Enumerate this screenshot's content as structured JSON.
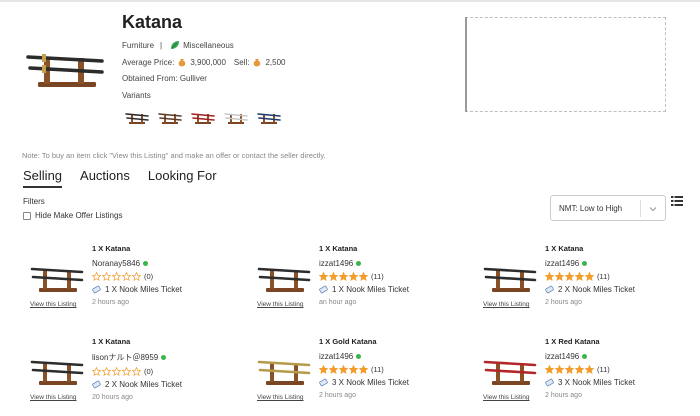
{
  "item": {
    "title": "Katana",
    "category": "Furniture",
    "separator": "|",
    "subcategory": "Miscellaneous",
    "avg_price_label": "Average Price:",
    "avg_price": "3,900,000",
    "sell_label": "Sell:",
    "sell_price": "2,500",
    "obtained_label": "Obtained From:",
    "obtained_from": "Gulliver",
    "variants_label": "Variants",
    "variant_colors": [
      "#2d2d2d",
      "#5a3b2a",
      "#a31f1f",
      "#c8c8c8",
      "#1f3a6b"
    ]
  },
  "note": "Note: To buy an item click \"View this Listing\" and make an offer or contact the seller directly.",
  "tabs": [
    {
      "label": "Selling"
    },
    {
      "label": "Auctions"
    },
    {
      "label": "Looking For"
    }
  ],
  "filters": {
    "label": "Filters",
    "hide_make_offer": "Hide Make Offer Listings",
    "sort_selected": "NMT: Low to High"
  },
  "icons": {
    "leaf": "leaf-icon",
    "bells": "bell-bag-icon",
    "ticket": "nook-miles-ticket-icon",
    "list_view": "list-view-icon",
    "chevron": "chevron-down-icon"
  },
  "colors": {
    "star": "#f39c2a",
    "online": "#39b54a",
    "leaf": "#3aa757"
  },
  "listings": [
    {
      "title": "1 X Katana",
      "seller": "Noranay5846",
      "rating": 0,
      "reviews": "(0)",
      "price": "1 X Nook Miles Ticket",
      "time": "2 hours ago",
      "view": "View this Listing",
      "blade": "#2d2d2d"
    },
    {
      "title": "1 X Katana",
      "seller": "izzat1496",
      "rating": 5,
      "reviews": "(11)",
      "price": "1 X Nook Miles Ticket",
      "time": "an hour ago",
      "view": "View this Listing",
      "blade": "#2d2d2d"
    },
    {
      "title": "1 X Katana",
      "seller": "izzat1496",
      "rating": 5,
      "reviews": "(11)",
      "price": "2 X Nook Miles Ticket",
      "time": "2 hours ago",
      "view": "View this Listing",
      "blade": "#2d2d2d"
    },
    {
      "title": "1 X Katana",
      "seller": "lisonナルト＠8959",
      "rating": 0,
      "reviews": "(0)",
      "price": "2 X Nook Miles Ticket",
      "time": "20 hours ago",
      "view": "View this Listing",
      "blade": "#2d2d2d"
    },
    {
      "title": "1 X Gold Katana",
      "seller": "izzat1496",
      "rating": 5,
      "reviews": "(11)",
      "price": "3 X Nook Miles Ticket",
      "time": "2 hours ago",
      "view": "View this Listing",
      "blade": "#b59a4a"
    },
    {
      "title": "1 X Red Katana",
      "seller": "izzat1496",
      "rating": 5,
      "reviews": "(11)",
      "price": "3 X Nook Miles Ticket",
      "time": "2 hours ago",
      "view": "View this Listing",
      "blade": "#b3262a"
    }
  ]
}
